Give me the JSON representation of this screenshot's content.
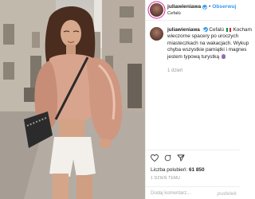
{
  "header": {
    "username": "juliawieniawa",
    "follow_label": "Obserwuj",
    "location": "Cefalù"
  },
  "caption": {
    "username": "juliawieniawa",
    "line1": "Cefalù",
    "line1_tail": "Kocham",
    "line2": "wieczorne spacery po uroczych",
    "line3": "miasteczkach na wakacjach. Wykup",
    "line4": "chyba wszystkie pamiątki i magnes",
    "line5": "jestem typową turystką",
    "time_ago": "1 dzień"
  },
  "likes": {
    "label": "Liczba polubień:",
    "count": "61 850"
  },
  "post_date": "1 DZIEŃ TEMU",
  "comment_placeholder": "Dodaj komentarz...",
  "watermark": "pudelek",
  "colors": {
    "link": "#3897f0",
    "muted": "#999999",
    "border": "#efefef"
  },
  "icons": [
    "heart-icon",
    "comment-icon",
    "share-icon",
    "verified-icon"
  ]
}
